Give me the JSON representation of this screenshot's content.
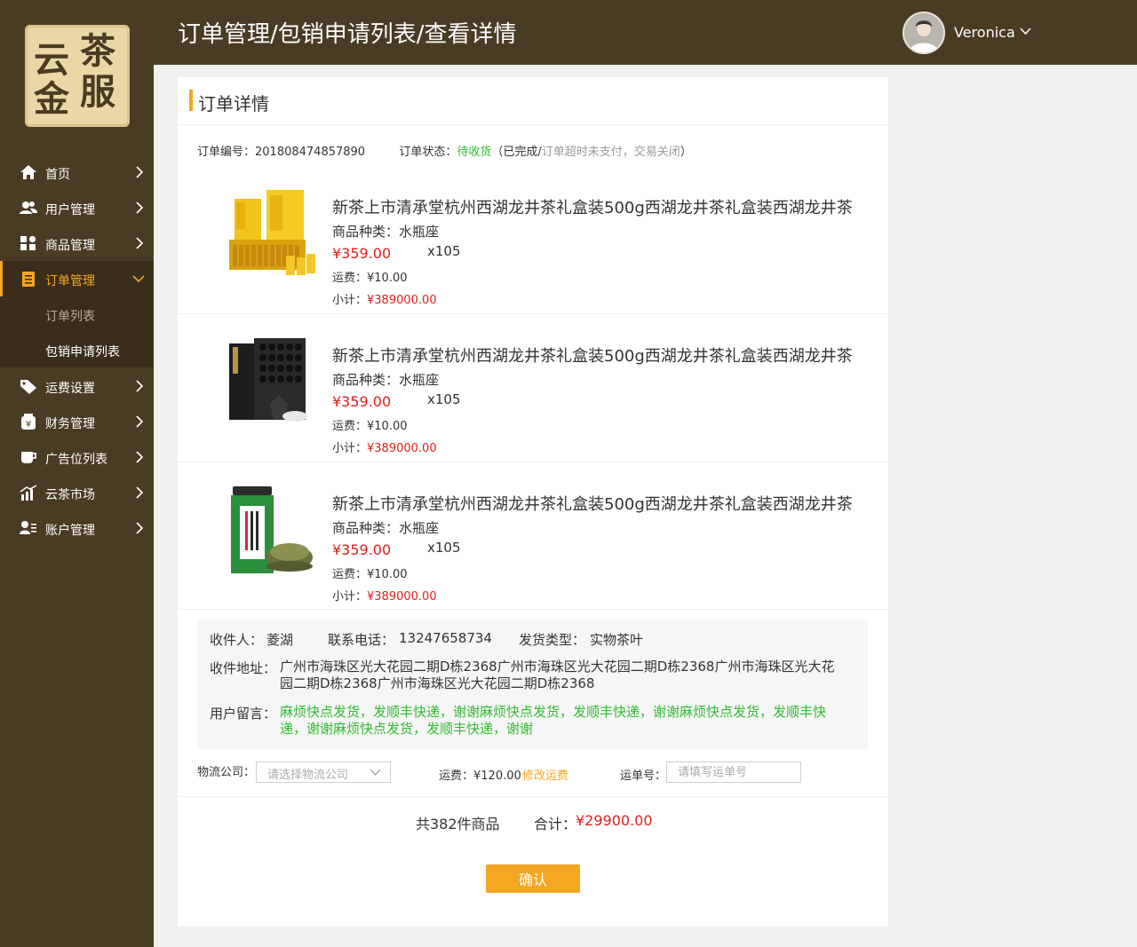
{
  "logo": {
    "chars": [
      "云",
      "茶",
      "金",
      "服"
    ]
  },
  "sidebar": {
    "items": [
      {
        "label": "首页",
        "icon": "home-icon"
      },
      {
        "label": "用户管理",
        "icon": "users-icon"
      },
      {
        "label": "商品管理",
        "icon": "grid-icon"
      },
      {
        "label": "订单管理",
        "icon": "clipboard-icon",
        "active": true
      },
      {
        "label": "运费设置",
        "icon": "tag-icon"
      },
      {
        "label": "财务管理",
        "icon": "yen-jar-icon"
      },
      {
        "label": "广告位列表",
        "icon": "cup-icon"
      },
      {
        "label": "云茶市场",
        "icon": "chart-icon"
      },
      {
        "label": "账户管理",
        "icon": "account-icon"
      }
    ],
    "subitems": [
      "订单列表",
      "包销申请列表"
    ]
  },
  "header": {
    "breadcrumb": "订单管理/包销申请列表/查看详情",
    "username": "Veronica"
  },
  "panel": {
    "title": "订单详情",
    "order_no_label": "订单编号：",
    "order_no": "201808474857890",
    "status_label": "订单状态：",
    "status_current": "待收货",
    "status_paren_open": "（已完成/",
    "status_other": "订单超时未支付，交易关闭",
    "status_paren_close": "）"
  },
  "products": [
    {
      "title": "新茶上市清承堂杭州西湖龙井茶礼盒装500g西湖龙井茶礼盒装西湖龙井茶",
      "category_label": "商品种类：",
      "category": "水瓶座",
      "price": "¥359.00",
      "qty": "x105",
      "shipping_label": "运费：",
      "shipping": "¥10.00",
      "subtotal_label": "小计：",
      "subtotal": "¥389000.00",
      "image": "yellow-tea-box"
    },
    {
      "title": "新茶上市清承堂杭州西湖龙井茶礼盒装500g西湖龙井茶礼盒装西湖龙井茶",
      "category_label": "商品种类：",
      "category": "水瓶座",
      "price": "¥359.00",
      "qty": "x105",
      "shipping_label": "运费：",
      "shipping": "¥10.00",
      "subtotal_label": "小计：",
      "subtotal": "¥389000.00",
      "image": "black-tea-box"
    },
    {
      "title": "新茶上市清承堂杭州西湖龙井茶礼盒装500g西湖龙井茶礼盒装西湖龙井茶",
      "category_label": "商品种类：",
      "category": "水瓶座",
      "price": "¥359.00",
      "qty": "x105",
      "shipping_label": "运费：",
      "shipping": "¥10.00",
      "subtotal_label": "小计：",
      "subtotal": "¥389000.00",
      "image": "green-tea-can"
    }
  ],
  "recipient": {
    "name_label": "收件人：",
    "name": "菱湖",
    "phone_label": "联系电话：",
    "phone": "13247658734",
    "type_label": "发货类型：",
    "type": "实物茶叶",
    "address_label": "收件地址：",
    "address_line1": "广州市海珠区光大花园二期D栋2368广州市海珠区光大花园二期D栋2368广州市海珠区光大花",
    "address_line2": "园二期D栋2368广州市海珠区光大花园二期D栋2368",
    "message_label": "用户留言：",
    "message_line1": "麻烦快点发货，发顺丰快递，谢谢麻烦快点发货，发顺丰快递，谢谢麻烦快点发货，发顺丰快",
    "message_line2": "递，谢谢麻烦快点发货，发顺丰快递，谢谢"
  },
  "logistics": {
    "company_label": "物流公司：",
    "company_placeholder": "请选择物流公司",
    "fee_label": "运费：",
    "fee": "¥120.00",
    "modify_fee": "修改运费",
    "waybill_label": "运单号：",
    "waybill_placeholder": "请填写运单号"
  },
  "totals": {
    "count_text": "共382件商品",
    "total_label": "合计：",
    "total_value": "¥29900.00"
  },
  "confirm_label": "确认",
  "colors": {
    "brown": "#4a3b24",
    "accent": "#f5a623",
    "price_red": "#e0201c",
    "status_green": "#2fbb2f"
  }
}
